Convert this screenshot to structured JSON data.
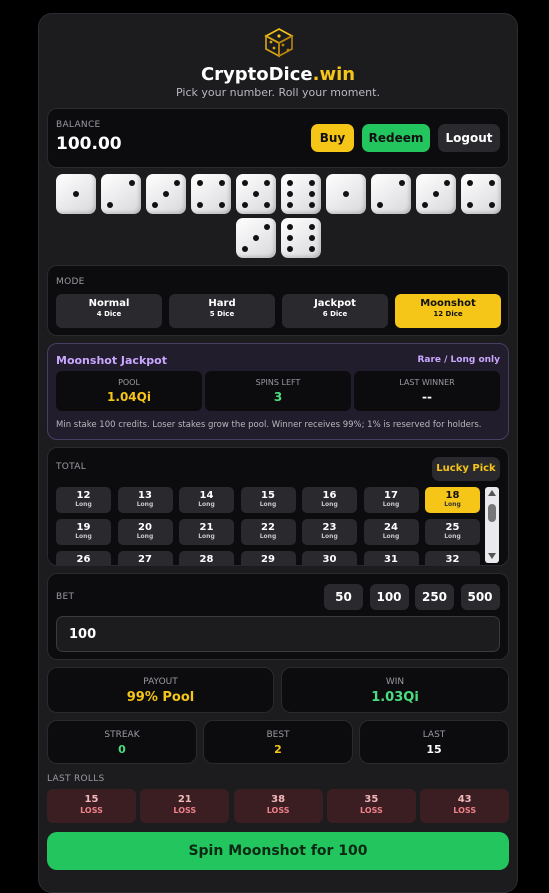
{
  "header": {
    "logo_icon": "dice-cube-icon",
    "title_main": "CryptoDice",
    "title_accent": ".win",
    "subtitle": "Pick your number. Roll your moment."
  },
  "balance": {
    "label": "BALANCE",
    "value": "100.00",
    "buy_label": "Buy",
    "redeem_label": "Redeem",
    "logout_label": "Logout"
  },
  "dice": [
    1,
    2,
    3,
    4,
    5,
    6,
    1,
    2,
    3,
    4,
    3,
    6
  ],
  "mode": {
    "label": "MODE",
    "options": [
      {
        "name": "Normal",
        "dice": "4 Dice"
      },
      {
        "name": "Hard",
        "dice": "5 Dice"
      },
      {
        "name": "Jackpot",
        "dice": "6 Dice"
      },
      {
        "name": "Moonshot",
        "dice": "12 Dice"
      }
    ],
    "selected": 3
  },
  "jackpot": {
    "title": "Moonshot Jackpot",
    "tag": "Rare / Long only",
    "pool_label": "POOL",
    "pool_value": "1.04Qi",
    "spins_label": "SPINS LEFT",
    "spins_value": "3",
    "winner_label": "LAST WINNER",
    "winner_value": "--",
    "note": "Min stake 100 credits. Loser stakes grow the pool. Winner receives 99%; 1% is reserved for holders."
  },
  "total": {
    "label": "TOTAL",
    "lucky_label": "Lucky Pick",
    "cells": [
      {
        "n": "12",
        "s": "Long"
      },
      {
        "n": "13",
        "s": "Long"
      },
      {
        "n": "14",
        "s": "Long"
      },
      {
        "n": "15",
        "s": "Long"
      },
      {
        "n": "16",
        "s": "Long"
      },
      {
        "n": "17",
        "s": "Long"
      },
      {
        "n": "18",
        "s": "Long"
      },
      {
        "n": "19",
        "s": "Long"
      },
      {
        "n": "20",
        "s": "Long"
      },
      {
        "n": "21",
        "s": "Long"
      },
      {
        "n": "22",
        "s": "Long"
      },
      {
        "n": "23",
        "s": "Long"
      },
      {
        "n": "24",
        "s": "Long"
      },
      {
        "n": "25",
        "s": "Long"
      },
      {
        "n": "26",
        "s": "Long"
      },
      {
        "n": "27",
        "s": "Long"
      },
      {
        "n": "28",
        "s": "Long"
      },
      {
        "n": "29",
        "s": "Long"
      },
      {
        "n": "30",
        "s": "Long"
      },
      {
        "n": "31",
        "s": "Long"
      },
      {
        "n": "32",
        "s": "Long"
      }
    ],
    "selected": 6,
    "scroll_up_icon": "scroll-up-arrow-icon",
    "scroll_down_icon": "scroll-down-arrow-icon"
  },
  "bet": {
    "label": "BET",
    "chips": [
      "50",
      "100",
      "250",
      "500"
    ],
    "value": "100"
  },
  "payout": {
    "label": "PAYOUT",
    "value": "99% Pool"
  },
  "win": {
    "label": "WIN",
    "value": "1.03Qi"
  },
  "streak": {
    "label": "STREAK",
    "value": "0"
  },
  "best": {
    "label": "BEST",
    "value": "2"
  },
  "last": {
    "label": "LAST",
    "value": "15"
  },
  "last_rolls": {
    "label": "LAST ROLLS",
    "items": [
      {
        "n": "15",
        "r": "LOSS"
      },
      {
        "n": "21",
        "r": "LOSS"
      },
      {
        "n": "38",
        "r": "LOSS"
      },
      {
        "n": "35",
        "r": "LOSS"
      },
      {
        "n": "43",
        "r": "LOSS"
      }
    ]
  },
  "spin_label": "Spin Moonshot for 100",
  "colors": {
    "yellow": "#f5c518",
    "green": "#22c55e",
    "purple_tag": "#c9a7ff",
    "loss_bg": "#3a1e21"
  }
}
